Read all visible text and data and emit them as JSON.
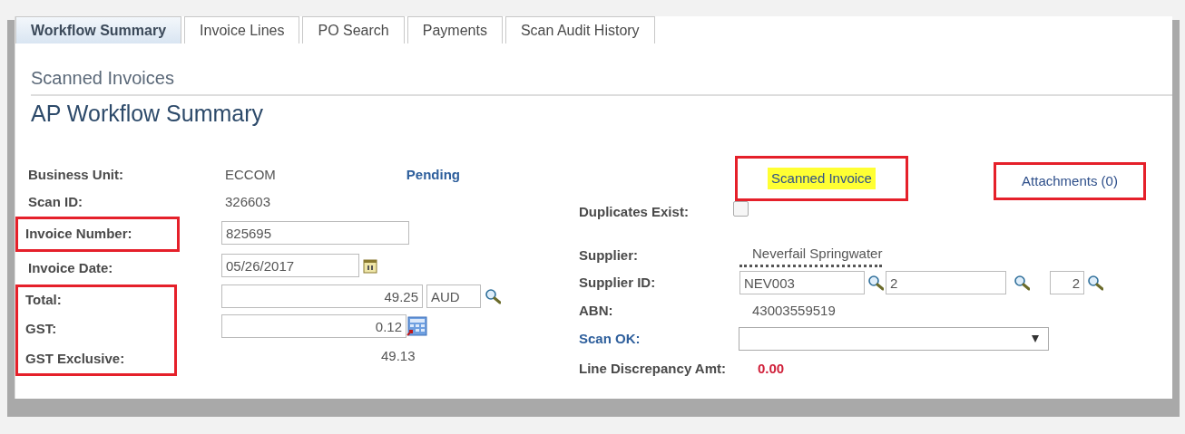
{
  "tabs": [
    {
      "label": "Workflow Summary",
      "selected": true
    },
    {
      "label": "Invoice Lines",
      "selected": false
    },
    {
      "label": "PO Search",
      "selected": false
    },
    {
      "label": "Payments",
      "selected": false
    },
    {
      "label": "Scan Audit History",
      "selected": false
    }
  ],
  "breadcrumb": "Scanned Invoices",
  "page_title": "AP Workflow Summary",
  "left_fields": [
    {
      "label": "Business Unit:",
      "kind": "text",
      "value": "ECCOM",
      "status": "Pending",
      "outlined": false
    },
    {
      "label": "Scan ID:",
      "kind": "text",
      "value": "326603",
      "outlined": false
    },
    {
      "label": "Invoice Number:",
      "kind": "input",
      "value": "825695",
      "outlined": true
    },
    {
      "label": "Invoice Date:",
      "kind": "date",
      "value": "05/26/2017",
      "outlined": false
    },
    {
      "label": "Total:",
      "kind": "amount",
      "value": "49.25",
      "currency": "AUD",
      "outlined": true
    },
    {
      "label": "GST:",
      "kind": "calc",
      "value": "0.12",
      "outlined": true
    },
    {
      "label": "GST Exclusive:",
      "kind": "readonly_amount",
      "value": "49.13",
      "outlined": true
    }
  ],
  "scanned_invoice": {
    "label": "Scanned Invoice",
    "highlighted": true,
    "outlined": true
  },
  "attachments": {
    "label": "Attachments (0)",
    "outlined": true
  },
  "right_fields": [
    {
      "label": "Duplicates Exist:",
      "kind": "checkbox",
      "checked": false
    },
    {
      "label": "Supplier:",
      "kind": "link_text",
      "value": "Neverfail Springwater"
    },
    {
      "label": "Supplier ID:",
      "kind": "lookups",
      "values": [
        "NEV003",
        "2",
        "2"
      ]
    },
    {
      "label": "ABN:",
      "kind": "text",
      "value": "43003559519"
    },
    {
      "label": "Scan OK:",
      "kind": "select"
    },
    {
      "label": "Line Discrepancy Amt:",
      "kind": "discrepancy",
      "value": "0.00"
    }
  ]
}
